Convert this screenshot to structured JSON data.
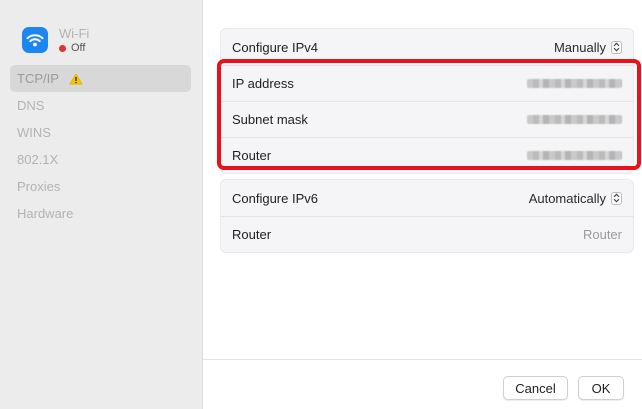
{
  "interface": {
    "name": "Wi-Fi",
    "status": "Off",
    "status_color": "#e5312d",
    "icon": "wifi-icon"
  },
  "sidebar": {
    "items": [
      {
        "label": "TCP/IP",
        "selected": true,
        "warning": true
      },
      {
        "label": "DNS"
      },
      {
        "label": "WINS"
      },
      {
        "label": "802.1X"
      },
      {
        "label": "Proxies"
      },
      {
        "label": "Hardware"
      }
    ]
  },
  "ipv4": {
    "configure_label": "Configure IPv4",
    "configure_value": "Manually",
    "ip_label": "IP address",
    "subnet_label": "Subnet mask",
    "router_label": "Router"
  },
  "ipv6": {
    "configure_label": "Configure IPv6",
    "configure_value": "Automatically",
    "router_label": "Router",
    "router_placeholder": "Router"
  },
  "footer": {
    "cancel_label": "Cancel",
    "ok_label": "OK"
  },
  "colors": {
    "highlight": "#e8131a",
    "accent": "#1e86f0",
    "warning": "#f5c400"
  }
}
